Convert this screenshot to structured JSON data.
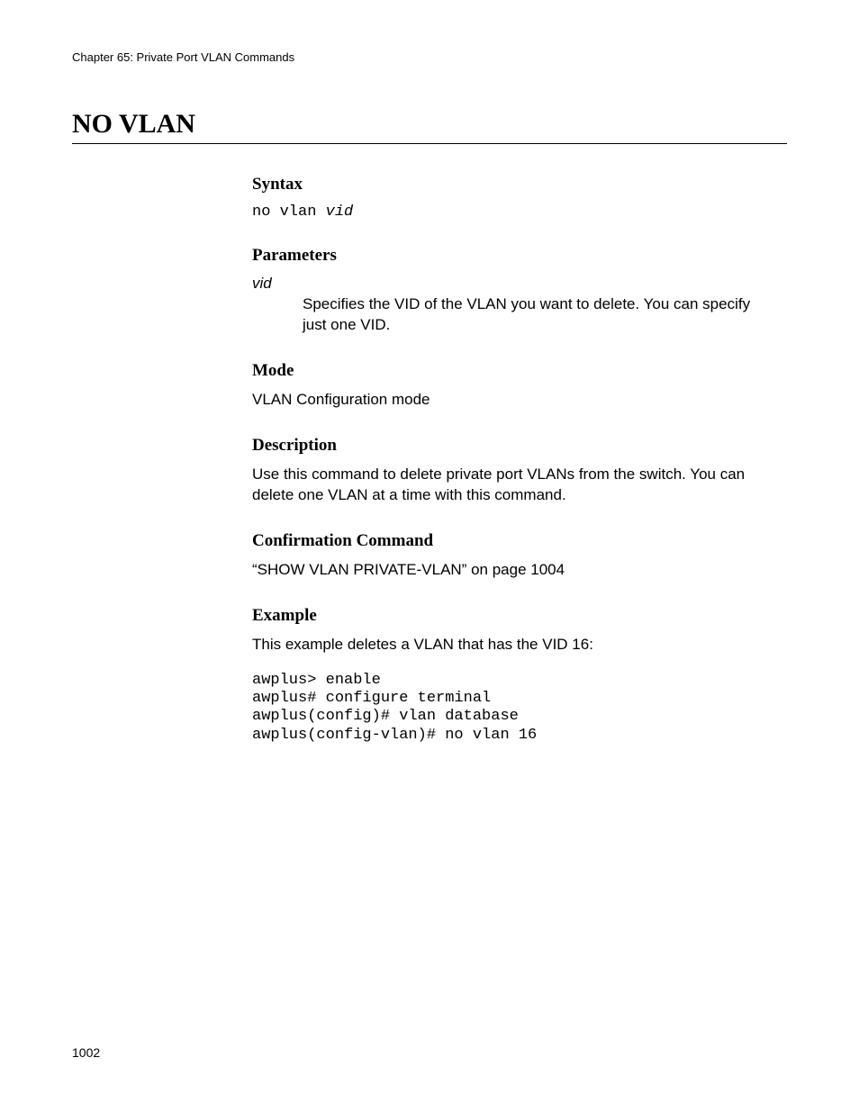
{
  "header": {
    "chapter": "Chapter 65: Private Port VLAN Commands"
  },
  "title": "NO VLAN",
  "sections": {
    "syntax": {
      "heading": "Syntax",
      "command_prefix": "no vlan ",
      "command_arg": "vid"
    },
    "parameters": {
      "heading": "Parameters",
      "name": "vid",
      "desc": "Specifies the VID of the VLAN you want to delete. You can specify just one VID."
    },
    "mode": {
      "heading": "Mode",
      "text": "VLAN Configuration mode"
    },
    "description": {
      "heading": "Description",
      "text": "Use this command to delete private port VLANs from the switch. You can delete one VLAN at a time with this command."
    },
    "confirmation": {
      "heading": "Confirmation Command",
      "text": "“SHOW VLAN PRIVATE-VLAN” on page 1004"
    },
    "example": {
      "heading": "Example",
      "intro": "This example deletes a VLAN that has the VID 16:",
      "code": "awplus> enable\nawplus# configure terminal\nawplus(config)# vlan database\nawplus(config-vlan)# no vlan 16"
    }
  },
  "page_number": "1002"
}
